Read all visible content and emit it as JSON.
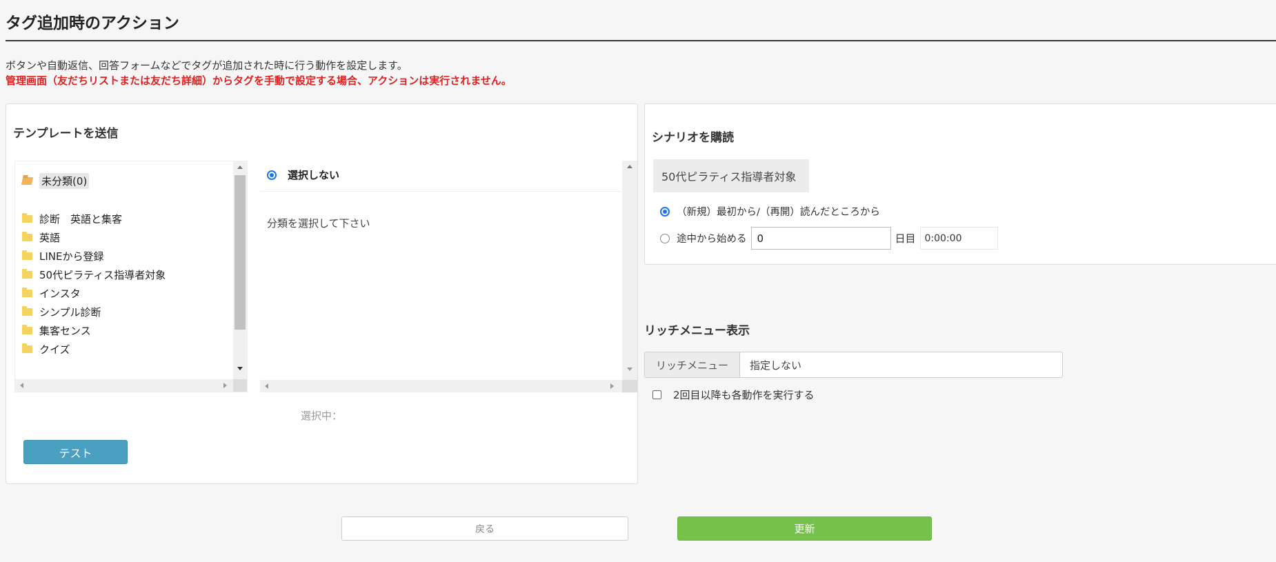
{
  "page": {
    "title": "タグ追加時のアクション",
    "description": "ボタンや自動返信、回答フォームなどでタグが追加された時に行う動作を設定します。",
    "warning": "管理画面（友だちリストまたは友だち詳細）からタグを手動で設定する場合、アクションは実行されません。"
  },
  "template_section": {
    "heading": "テンプレートを送信",
    "tree": {
      "selected_folder": "未分類(0)",
      "folders": [
        "診断　英語と集客",
        "英語",
        "LINEから登録",
        "50代ピラティス指導者対象",
        "インスタ",
        "シンプル診断",
        "集客センス",
        "クイズ"
      ],
      "folder_icon": "folder-icon",
      "selected_folder_icon": "folder-open-icon"
    },
    "none_option_label": "選択しない",
    "hint": "分類を選択して下さい",
    "selected_status": "選択中：",
    "test_button": "テスト"
  },
  "scenario_section": {
    "heading": "シナリオを購読",
    "selected_scenario": "50代ピラティス指導者対象",
    "option_restart": "（新規）最初から/（再開）読んだところから",
    "option_midway": "途中から始める",
    "midway_day_value": "0",
    "day_unit": "日目",
    "time_value": "0:00:00",
    "selected_option": "restart"
  },
  "rich_menu_section": {
    "heading": "リッチメニュー表示",
    "addon_label": "リッチメニュー",
    "value": "指定しない",
    "repeat_checkbox_label": "2回目以降も各動作を実行する",
    "repeat_checked": false
  },
  "footer": {
    "back_button": "戻る",
    "update_button": "更新",
    "update_color": "#76c14a"
  },
  "colors": {
    "warning": "#e02020",
    "test_button": "#4aa0c0",
    "radio_accent": "#1a73e8"
  }
}
